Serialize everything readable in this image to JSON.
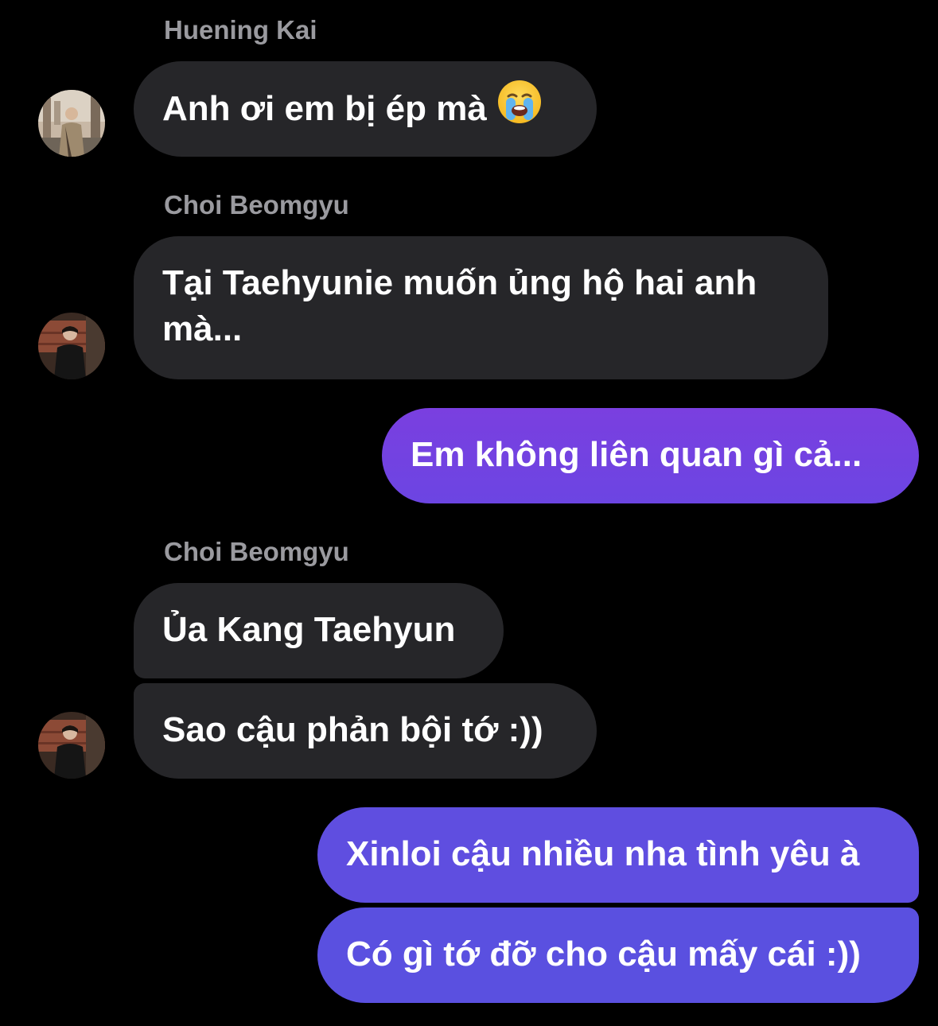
{
  "thread": {
    "messages": [
      {
        "type": "name",
        "text": "Huening Kai"
      },
      {
        "type": "incoming",
        "text": "Anh ơi em bị ép mà",
        "emoji": "loudly-crying-face"
      },
      {
        "type": "name",
        "text": "Choi Beomgyu"
      },
      {
        "type": "incoming",
        "text": "Tại Taehyunie muốn ủng hộ hai anh mà..."
      },
      {
        "type": "outgoing",
        "text": "Em không liên quan gì cả..."
      },
      {
        "type": "name",
        "text": "Choi Beomgyu"
      },
      {
        "type": "incoming",
        "text": "Ủa Kang Taehyun"
      },
      {
        "type": "incoming",
        "text": "Sao cậu phản bội tớ :))"
      },
      {
        "type": "outgoing",
        "text": "Xinloi cậu nhiều nha tình yêu à"
      },
      {
        "type": "outgoing",
        "text": "Có gì tớ đỡ cho cậu mấy cái :))"
      }
    ]
  },
  "colors": {
    "background": "#000000",
    "incoming_bubble": "#262629",
    "sender_name": "#9a9a9f",
    "outgoing_gradient_top": "#7a3fe0",
    "outgoing_gradient_bottom": "#5b4ee0"
  }
}
